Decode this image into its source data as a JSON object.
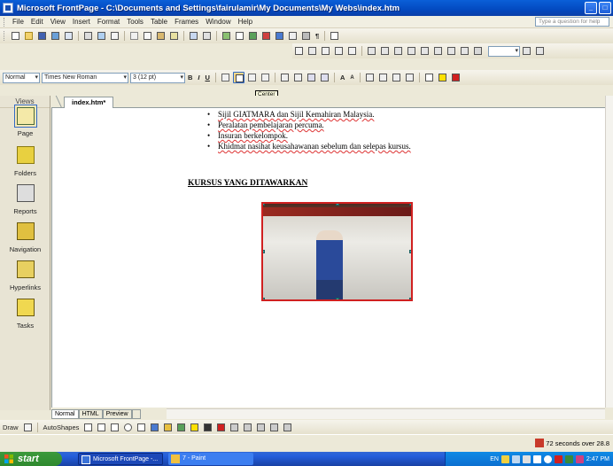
{
  "window": {
    "title": "Microsoft FrontPage - C:\\Documents and Settings\\fairulamir\\My Documents\\My Webs\\index.htm",
    "buttons": [
      "_",
      "□"
    ]
  },
  "menu": {
    "items": [
      "File",
      "Edit",
      "View",
      "Insert",
      "Format",
      "Tools",
      "Table",
      "Frames",
      "Window",
      "Help"
    ],
    "help_placeholder": "Type a question for help"
  },
  "format_toolbar": {
    "style": "Normal",
    "font": "Times New Roman",
    "size": "3 (12 pt)",
    "bold": "B",
    "italic": "I",
    "underline": "U"
  },
  "tooltip": "Center",
  "views": {
    "title": "Views",
    "items": [
      {
        "label": "Page",
        "icon": "page-view-icon"
      },
      {
        "label": "Folders",
        "icon": "folders-view-icon"
      },
      {
        "label": "Reports",
        "icon": "reports-view-icon"
      },
      {
        "label": "Navigation",
        "icon": "navigation-view-icon"
      },
      {
        "label": "Hyperlinks",
        "icon": "hyperlinks-view-icon"
      },
      {
        "label": "Tasks",
        "icon": "tasks-view-icon"
      }
    ]
  },
  "document": {
    "tab": "index.htm*",
    "bullets": [
      "Sijil GIATMARA dan Sijil Kemahiran Malaysia.",
      "Peralatan pembelajaran percuma.",
      "Insuran berkelompok.",
      "Khidmat nasihat keusahawanan sebelum dan selepas kursus."
    ],
    "heading": "KURSUS YANG DITAWARKAN"
  },
  "view_tabs": [
    "Normal",
    "HTML",
    "Preview"
  ],
  "drawing_toolbar": {
    "draw": "Draw",
    "autoshapes": "AutoShapes"
  },
  "status": {
    "timer": "72 seconds over 28.8"
  },
  "taskbar": {
    "start": "start",
    "tasks": [
      "Microsoft FrontPage -...",
      "7 - Paint"
    ],
    "lang": "EN",
    "clock": "2:47 PM"
  },
  "colors": {
    "title_bar": "#0349c0",
    "taskbar": "#245edb",
    "start_button": "#2f8a2f",
    "image_border": "#d02020"
  }
}
